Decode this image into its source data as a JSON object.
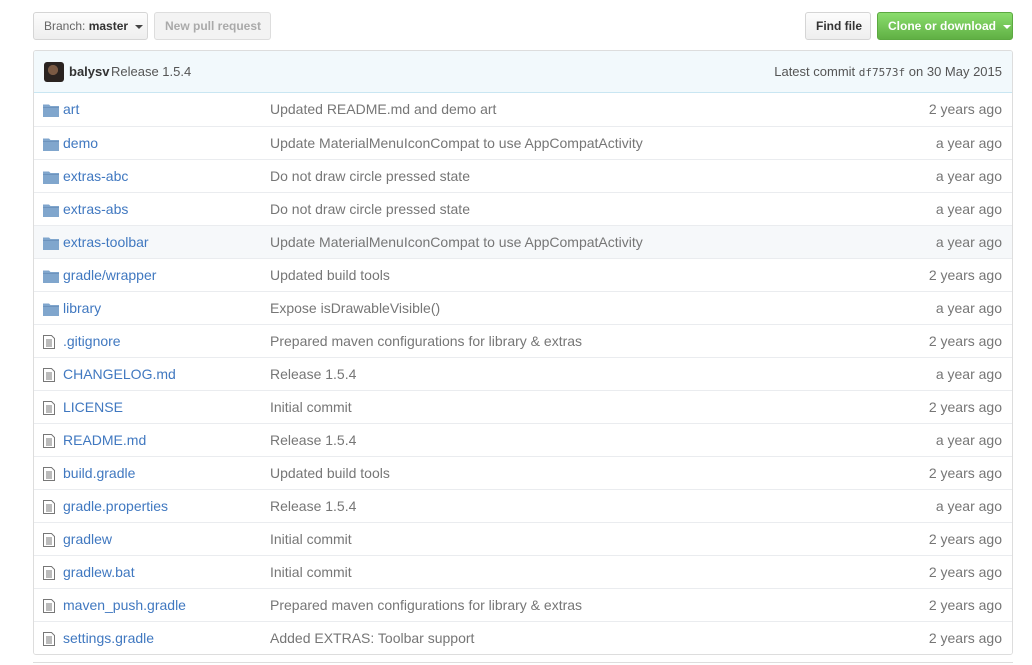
{
  "toolbar": {
    "branch_prefix": "Branch:",
    "branch_name": "master",
    "new_pull_request": "New pull request",
    "find_file": "Find file",
    "clone_download": "Clone or download"
  },
  "commit": {
    "author": "balysv",
    "message": "Release 1.5.4",
    "latest_label": "Latest commit",
    "sha": "df7573f",
    "date_text": "on 30 May 2015"
  },
  "files": [
    {
      "type": "folder",
      "name": "art",
      "message": "Updated README.md and demo art",
      "age": "2 years ago"
    },
    {
      "type": "folder",
      "name": "demo",
      "message": "Update MaterialMenuIconCompat to use AppCompatActivity",
      "age": "a year ago"
    },
    {
      "type": "folder",
      "name": "extras-abc",
      "message": "Do not draw circle pressed state",
      "age": "a year ago"
    },
    {
      "type": "folder",
      "name": "extras-abs",
      "message": "Do not draw circle pressed state",
      "age": "a year ago"
    },
    {
      "type": "folder",
      "name": "extras-toolbar",
      "message": "Update MaterialMenuIconCompat to use AppCompatActivity",
      "age": "a year ago"
    },
    {
      "type": "folder",
      "name": "gradle/wrapper",
      "message": "Updated build tools",
      "age": "2 years ago"
    },
    {
      "type": "folder",
      "name": "library",
      "message": "Expose isDrawableVisible()",
      "age": "a year ago"
    },
    {
      "type": "file",
      "name": ".gitignore",
      "message": "Prepared maven configurations for library & extras",
      "age": "2 years ago"
    },
    {
      "type": "file",
      "name": "CHANGELOG.md",
      "message": "Release 1.5.4",
      "age": "a year ago"
    },
    {
      "type": "file",
      "name": "LICENSE",
      "message": "Initial commit",
      "age": "2 years ago"
    },
    {
      "type": "file",
      "name": "README.md",
      "message": "Release 1.5.4",
      "age": "a year ago"
    },
    {
      "type": "file",
      "name": "build.gradle",
      "message": "Updated build tools",
      "age": "2 years ago"
    },
    {
      "type": "file",
      "name": "gradle.properties",
      "message": "Release 1.5.4",
      "age": "a year ago"
    },
    {
      "type": "file",
      "name": "gradlew",
      "message": "Initial commit",
      "age": "2 years ago"
    },
    {
      "type": "file",
      "name": "gradlew.bat",
      "message": "Initial commit",
      "age": "2 years ago"
    },
    {
      "type": "file",
      "name": "maven_push.gradle",
      "message": "Prepared maven configurations for library & extras",
      "age": "2 years ago"
    },
    {
      "type": "file",
      "name": "settings.gradle",
      "message": "Added EXTRAS: Toolbar support",
      "age": "2 years ago"
    }
  ],
  "hovered_row": "extras-toolbar",
  "colors": {
    "link": "#4078c0",
    "folder_icon": "#80a6cd",
    "file_icon": "#777777",
    "green": "#60b044"
  }
}
